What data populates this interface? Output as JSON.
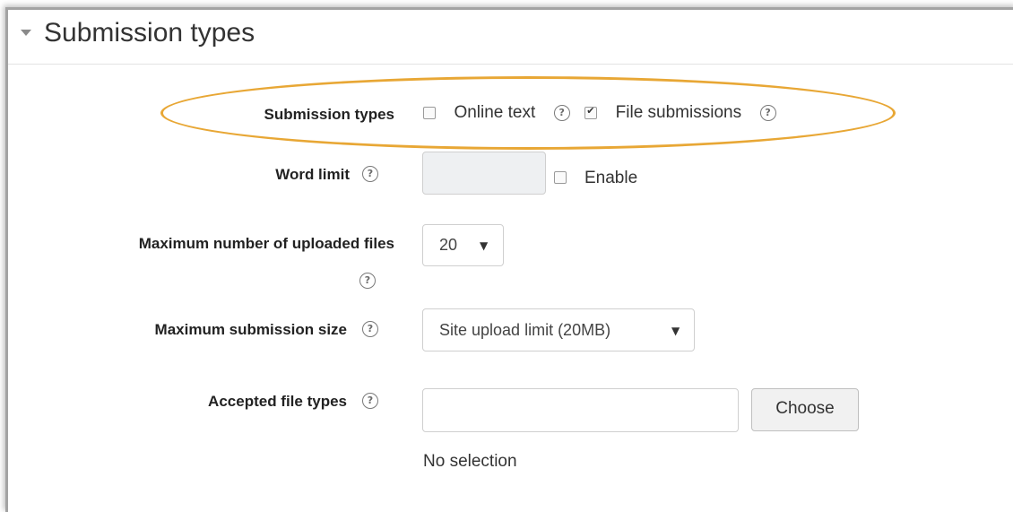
{
  "section": {
    "title": "Submission types"
  },
  "submission_types": {
    "label": "Submission types",
    "options": [
      {
        "label": "Online text",
        "checked": false
      },
      {
        "label": "File submissions",
        "checked": true
      }
    ],
    "highlight_color": "#e8a735"
  },
  "word_limit": {
    "label": "Word limit",
    "value": "",
    "enable_label": "Enable",
    "enabled": false
  },
  "max_files": {
    "label": "Maximum number of uploaded files",
    "value": "20"
  },
  "max_size": {
    "label": "Maximum submission size",
    "value": "Site upload limit (20MB)"
  },
  "file_types": {
    "label": "Accepted file types",
    "value": "",
    "choose_label": "Choose",
    "status": "No selection"
  },
  "help_glyph": "?",
  "dropdown_glyph": "▼"
}
